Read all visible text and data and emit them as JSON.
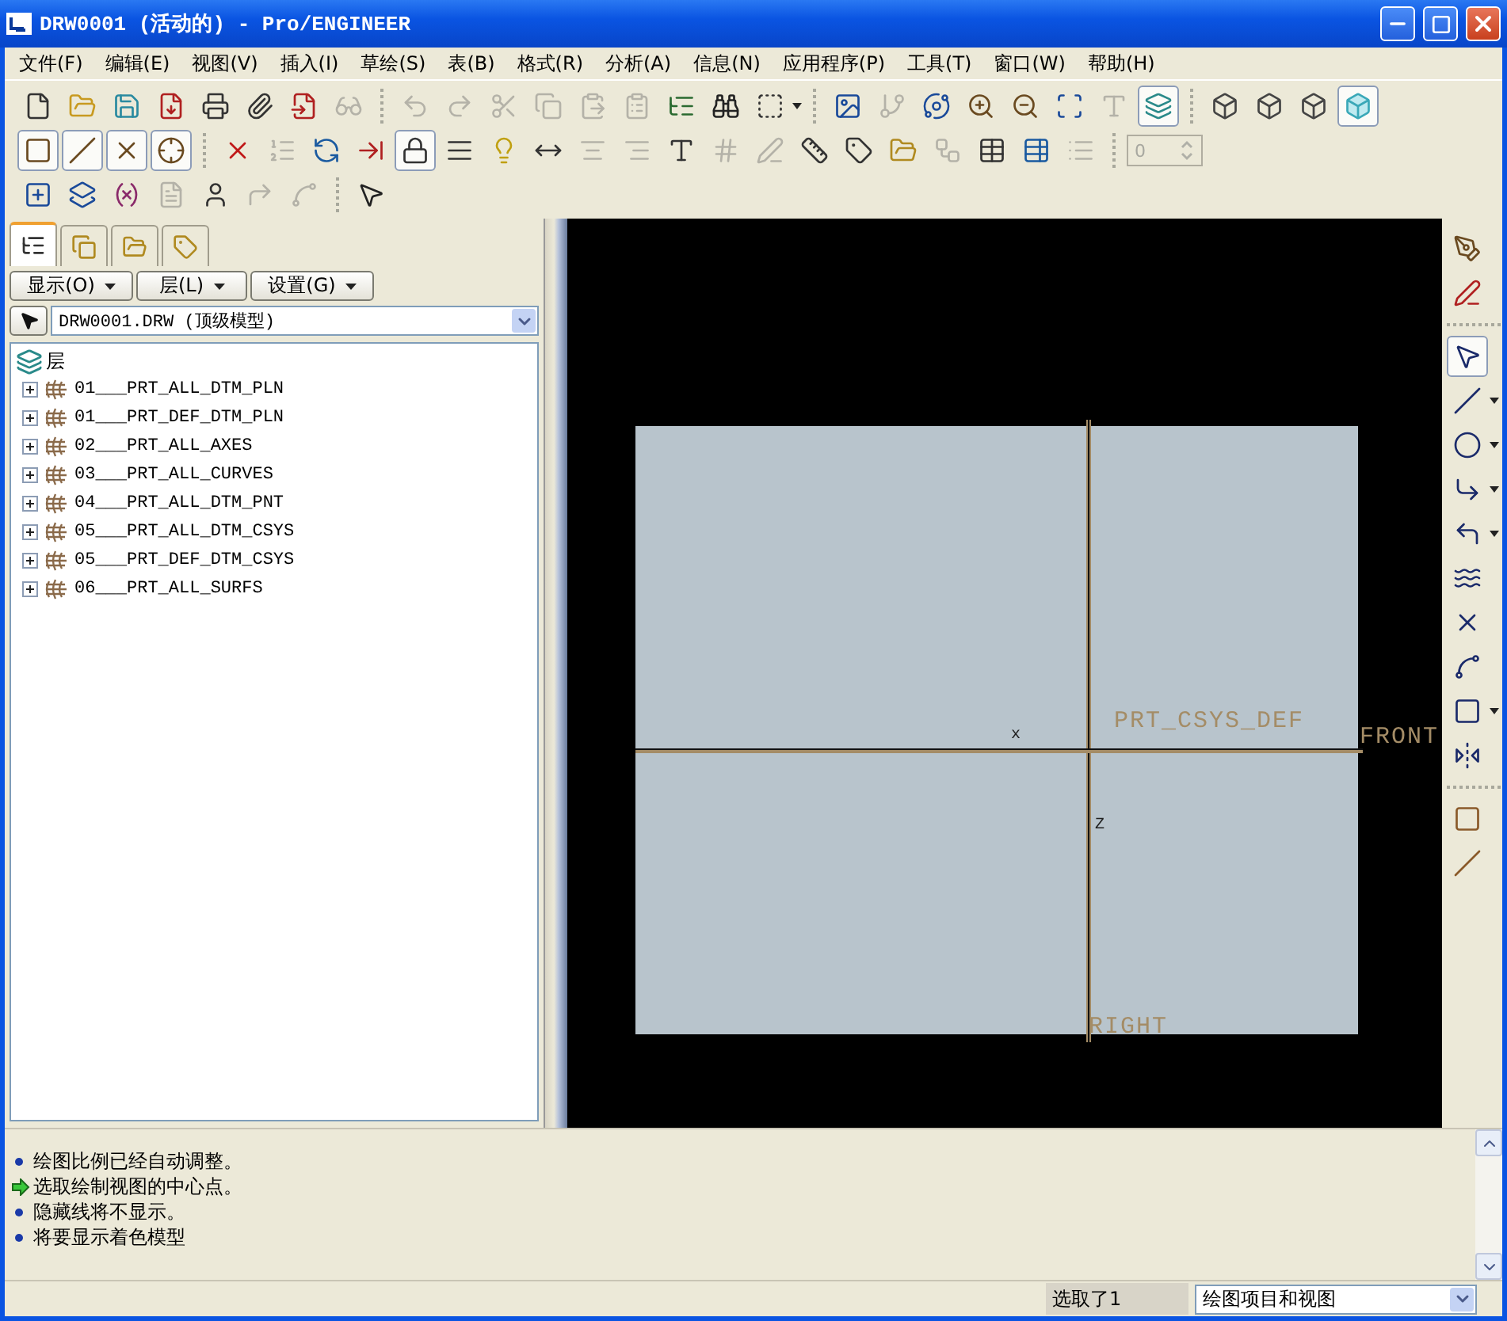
{
  "window": {
    "title": "DRW0001 (活动的) - Pro/ENGINEER"
  },
  "menu": [
    "文件(F)",
    "编辑(E)",
    "视图(V)",
    "插入(I)",
    "草绘(S)",
    "表(B)",
    "格式(R)",
    "分析(A)",
    "信息(N)",
    "应用程序(P)",
    "工具(T)",
    "窗口(W)",
    "帮助(H)"
  ],
  "toolbars": [
    [
      [
        {
          "on": false,
          "disabled": false
        },
        {
          "on": false,
          "disabled": false
        },
        {
          "on": false,
          "disabled": false
        },
        {
          "on": false,
          "disabled": false
        },
        {
          "on": false,
          "disabled": false
        },
        {
          "on": false,
          "disabled": false
        },
        {
          "on": false,
          "disabled": false
        },
        {
          "on": false,
          "disabled": true
        }
      ],
      [
        {
          "on": false,
          "disabled": true
        },
        {
          "on": false,
          "disabled": true
        },
        {
          "on": false,
          "disabled": true
        },
        {
          "on": false,
          "disabled": true
        },
        {
          "on": false,
          "disabled": true
        },
        {
          "on": false,
          "disabled": true
        },
        {
          "on": false,
          "disabled": false
        },
        {
          "on": false,
          "disabled": false
        },
        {
          "on": false,
          "disabled": false
        }
      ],
      [
        {
          "on": false,
          "disabled": false
        },
        {
          "on": false,
          "disabled": true
        },
        {
          "on": false,
          "disabled": false
        },
        {
          "on": false,
          "disabled": false
        },
        {
          "on": false,
          "disabled": false
        },
        {
          "on": false,
          "disabled": false
        },
        {
          "on": false,
          "disabled": true
        },
        {
          "on": true,
          "disabled": false
        }
      ],
      [
        {
          "on": false,
          "disabled": false
        },
        {
          "on": false,
          "disabled": false
        },
        {
          "on": false,
          "disabled": false
        },
        {
          "on": true,
          "disabled": false
        }
      ]
    ],
    [
      [
        {
          "on": true,
          "disabled": false
        },
        {
          "on": true,
          "disabled": false
        },
        {
          "on": true,
          "disabled": false
        },
        {
          "on": true,
          "disabled": false
        }
      ],
      [
        {
          "on": false,
          "disabled": false
        },
        {
          "on": false,
          "disabled": true
        },
        {
          "on": false,
          "disabled": false
        },
        {
          "on": false,
          "disabled": false
        },
        {
          "on": true,
          "disabled": false
        },
        {
          "on": false,
          "disabled": false
        },
        {
          "on": false,
          "disabled": false
        },
        {
          "on": false,
          "disabled": false
        },
        {
          "on": false,
          "disabled": true
        },
        {
          "on": false,
          "disabled": true
        },
        {
          "on": false,
          "disabled": false
        },
        {
          "on": false,
          "disabled": true
        },
        {
          "on": false,
          "disabled": true
        },
        {
          "on": false,
          "disabled": false
        },
        {
          "on": false,
          "disabled": false
        },
        {
          "on": false,
          "disabled": false
        },
        {
          "on": false,
          "disabled": true
        },
        {
          "on": false,
          "disabled": false
        },
        {
          "on": false,
          "disabled": false
        },
        {
          "on": false,
          "disabled": true
        }
      ]
    ],
    [
      [
        {
          "on": false,
          "disabled": false
        },
        {
          "on": false,
          "disabled": false
        },
        {
          "on": false,
          "disabled": false
        },
        {
          "on": false,
          "disabled": true
        },
        {
          "on": false,
          "disabled": false
        },
        {
          "on": false,
          "disabled": true
        },
        {
          "on": false,
          "disabled": true
        }
      ],
      [
        {
          "on": false,
          "disabled": false
        }
      ]
    ]
  ],
  "spinner": {
    "value": "0",
    "disabled": true
  },
  "panel": {
    "tabs": [
      {
        "selected": true
      },
      {
        "selected": false
      },
      {
        "selected": false
      },
      {
        "selected": false
      }
    ],
    "buttons": [
      "显示(O)",
      "层(L)",
      "设置(G)"
    ],
    "model": "DRW0001.DRW (顶级模型)",
    "tree": {
      "label": "层",
      "children": [
        {
          "label": "01___PRT_ALL_DTM_PLN",
          "expanded": false
        },
        {
          "label": "01___PRT_DEF_DTM_PLN",
          "expanded": false
        },
        {
          "label": "02___PRT_ALL_AXES",
          "expanded": false
        },
        {
          "label": "03___PRT_ALL_CURVES",
          "expanded": false
        },
        {
          "label": "04___PRT_ALL_DTM_PNT",
          "expanded": false
        },
        {
          "label": "05___PRT_ALL_DTM_CSYS",
          "expanded": false
        },
        {
          "label": "05___PRT_DEF_DTM_CSYS",
          "expanded": false
        },
        {
          "label": "06___PRT_ALL_SURFS",
          "expanded": false
        }
      ]
    }
  },
  "canvas": {
    "labels": [
      {
        "text": "PRT_CSYS_DEF",
        "kind": "datum"
      },
      {
        "text": "FRONT",
        "kind": "datum"
      },
      {
        "text": "RIGHT",
        "kind": "datum"
      },
      {
        "text": "x",
        "kind": "axis"
      },
      {
        "text": "Z",
        "kind": "axis"
      }
    ]
  },
  "right_toolbar": [
    [
      {
        "on": false
      },
      {
        "on": false
      }
    ],
    [
      {
        "on": true
      },
      {
        "on": false
      },
      {
        "on": false
      },
      {
        "on": false
      },
      {
        "on": false
      },
      {
        "on": false
      },
      {
        "on": false
      },
      {
        "on": false
      },
      {
        "on": false
      },
      {
        "on": false
      }
    ],
    [
      {
        "on": false
      },
      {
        "on": false
      }
    ]
  ],
  "messages": [
    {
      "kind": "info",
      "text": "绘图比例已经自动调整。"
    },
    {
      "kind": "prompt",
      "text": "选取绘制视图的中心点。"
    },
    {
      "kind": "info",
      "text": "隐藏线将不显示。"
    },
    {
      "kind": "info",
      "text": "将要显示着色模型"
    }
  ],
  "status": {
    "selection": "选取了1",
    "filter": "绘图项目和视图"
  }
}
